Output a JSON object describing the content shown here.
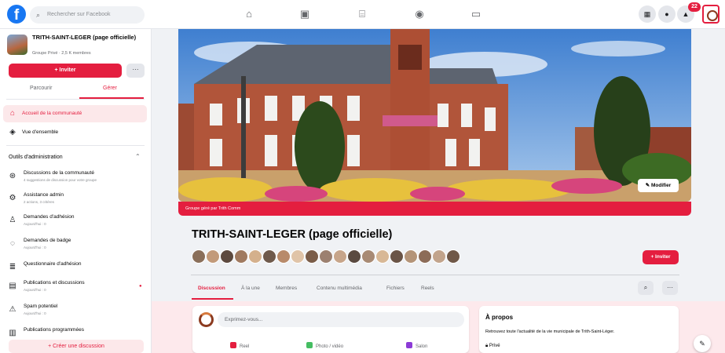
{
  "topbar": {
    "logo": "f",
    "search_placeholder": "Rechercher sur Facebook",
    "notification_count": "22"
  },
  "sidebar": {
    "group_name": "TRITH-SAINT-LEGER (page officielle)",
    "group_meta": "Groupe Privé · 2,5 K membres",
    "invite_label": "+ Inviter",
    "more_label": "···",
    "tabs": [
      {
        "label": "Parcourir"
      },
      {
        "label": "Gérer"
      }
    ],
    "nav_items": [
      {
        "label": "Accueil de la communauté",
        "icon": "home-icon"
      },
      {
        "label": "Vue d'ensemble",
        "icon": "overview-icon"
      }
    ],
    "admin_title": "Outils d'administration",
    "admin_items": [
      {
        "label": "Discussions de la communauté",
        "sub": "4 suggestions de discussion pour votre groupe"
      },
      {
        "label": "Assistance admin",
        "sub": "2 actions, 3 critères"
      },
      {
        "label": "Demandes d'adhésion",
        "sub": "Aujourd'hui : 0"
      },
      {
        "label": "Demandes de badge",
        "sub": "Aujourd'hui : 0"
      },
      {
        "label": "Questionnaire d'adhésion",
        "sub": ""
      },
      {
        "label": "Publications et discussions",
        "sub": "Aujourd'hui : 0"
      },
      {
        "label": "Spam potentiel",
        "sub": "Aujourd'hui : 0"
      },
      {
        "label": "Publications programmées",
        "sub": ""
      }
    ],
    "create_discussion_label": "+ Créer une discussion"
  },
  "cover": {
    "edit_label": "Modifier",
    "managed_by": "Groupe géré par Trith Comm"
  },
  "main": {
    "title": "TRITH-SAINT-LEGER (page officielle)",
    "invite_label": "+ Inviter",
    "tabs": [
      {
        "label": "Discussion"
      },
      {
        "label": "À la une"
      },
      {
        "label": "Membres"
      },
      {
        "label": "Contenu multimédia"
      },
      {
        "label": "Fichiers"
      },
      {
        "label": "Reels"
      }
    ],
    "search_button": "🔍",
    "more_button": "···"
  },
  "composer": {
    "placeholder": "Exprimez-vous...",
    "actions": [
      {
        "label": "Reel",
        "color": "#e41e3f"
      },
      {
        "label": "Photo / vidéo",
        "color": "#45bd62"
      },
      {
        "label": "Salon",
        "color": "#8c3bd6"
      }
    ]
  },
  "about": {
    "title": "À propos",
    "text": "Retrouvez toute l'actualité de la vie municipale de Trith-Saint-Léger.",
    "privacy": "Privé"
  },
  "colors": {
    "accent": "#e41e3f",
    "facebook_blue": "#1877f2"
  }
}
